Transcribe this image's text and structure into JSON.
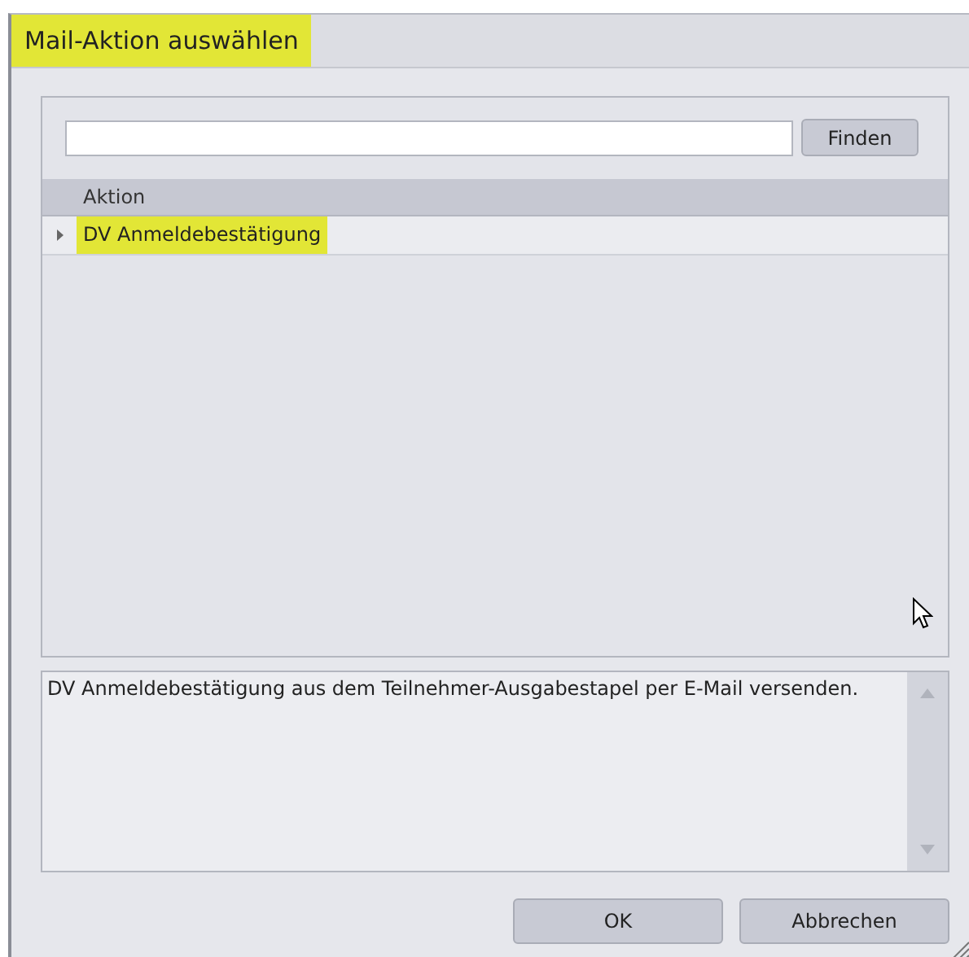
{
  "window": {
    "title": "Mail-Aktion auswählen",
    "title_highlighted": true
  },
  "search": {
    "button": "Finden"
  },
  "table": {
    "columns": [
      "Aktion"
    ],
    "rows": [
      {
        "cells": [
          "DV Anmeldebestätigung"
        ],
        "expanded": false,
        "highlighted": true
      }
    ]
  },
  "description": "DV Anmeldebestätigung aus dem Teilnehmer-Ausgabestapel per E-Mail versenden.",
  "buttons": [
    "OK",
    "Abbrechen"
  ]
}
